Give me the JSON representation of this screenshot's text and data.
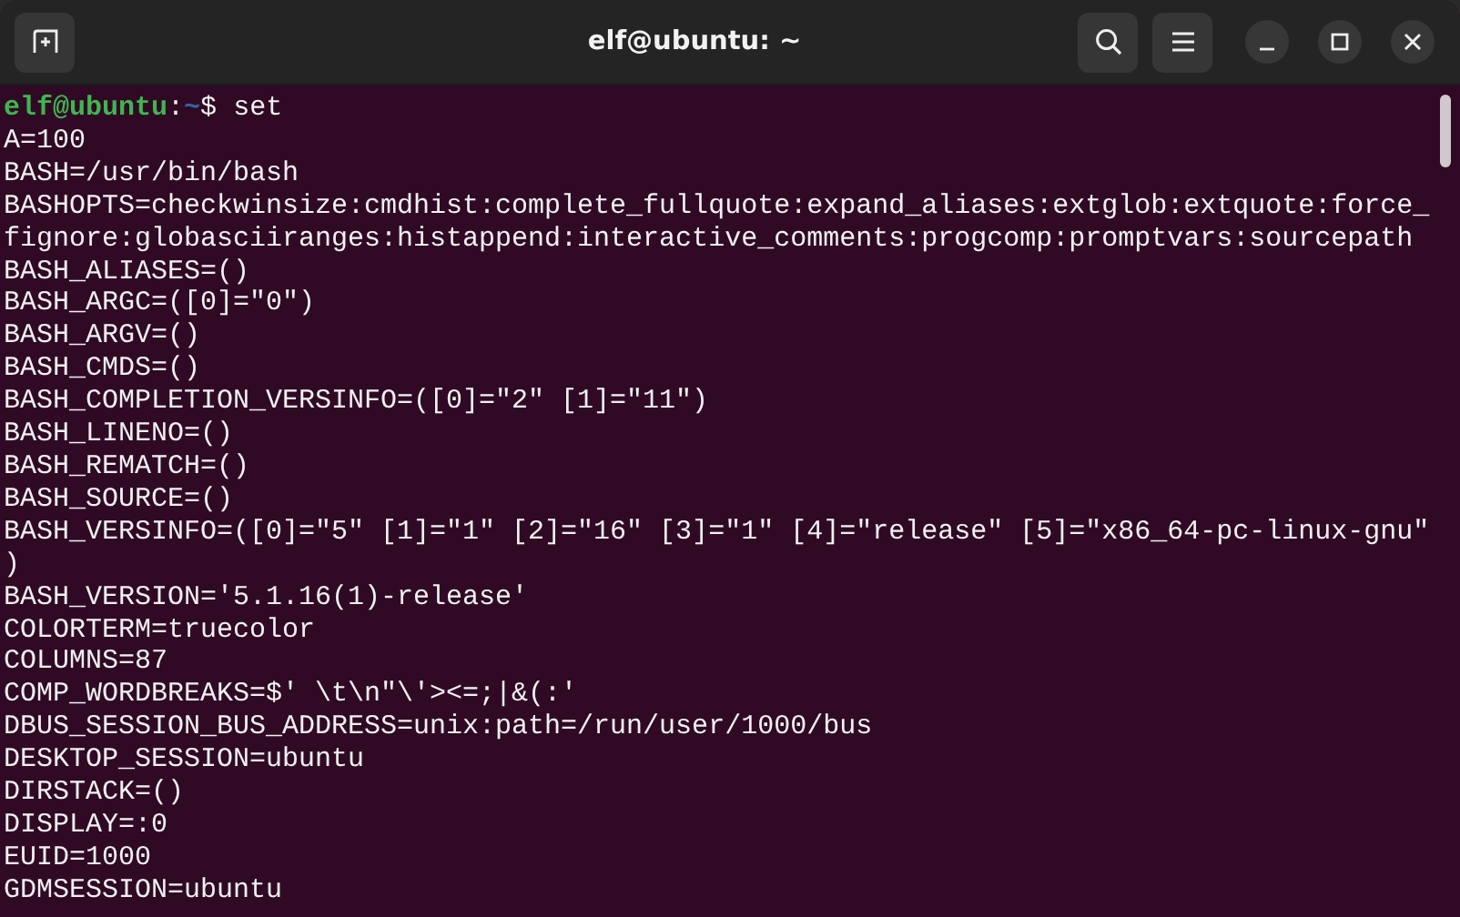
{
  "window": {
    "title": "elf@ubuntu: ~"
  },
  "prompt": {
    "user_host": "elf@ubuntu",
    "separator": ":",
    "path": "~",
    "symbol": "$",
    "command": "set"
  },
  "output_lines": [
    "A=100",
    "BASH=/usr/bin/bash",
    "BASHOPTS=checkwinsize:cmdhist:complete_fullquote:expand_aliases:extglob:extquote:force_",
    "fignore:globasciiranges:histappend:interactive_comments:progcomp:promptvars:sourcepath",
    "BASH_ALIASES=()",
    "BASH_ARGC=([0]=\"0\")",
    "BASH_ARGV=()",
    "BASH_CMDS=()",
    "BASH_COMPLETION_VERSINFO=([0]=\"2\" [1]=\"11\")",
    "BASH_LINENO=()",
    "BASH_REMATCH=()",
    "BASH_SOURCE=()",
    "BASH_VERSINFO=([0]=\"5\" [1]=\"1\" [2]=\"16\" [3]=\"1\" [4]=\"release\" [5]=\"x86_64-pc-linux-gnu\"",
    ")",
    "BASH_VERSION='5.1.16(1)-release'",
    "COLORTERM=truecolor",
    "COLUMNS=87",
    "COMP_WORDBREAKS=$' \\t\\n\"\\'><=;|&(:'",
    "DBUS_SESSION_BUS_ADDRESS=unix:path=/run/user/1000/bus",
    "DESKTOP_SESSION=ubuntu",
    "DIRSTACK=()",
    "DISPLAY=:0",
    "EUID=1000",
    "GDMSESSION=ubuntu"
  ]
}
